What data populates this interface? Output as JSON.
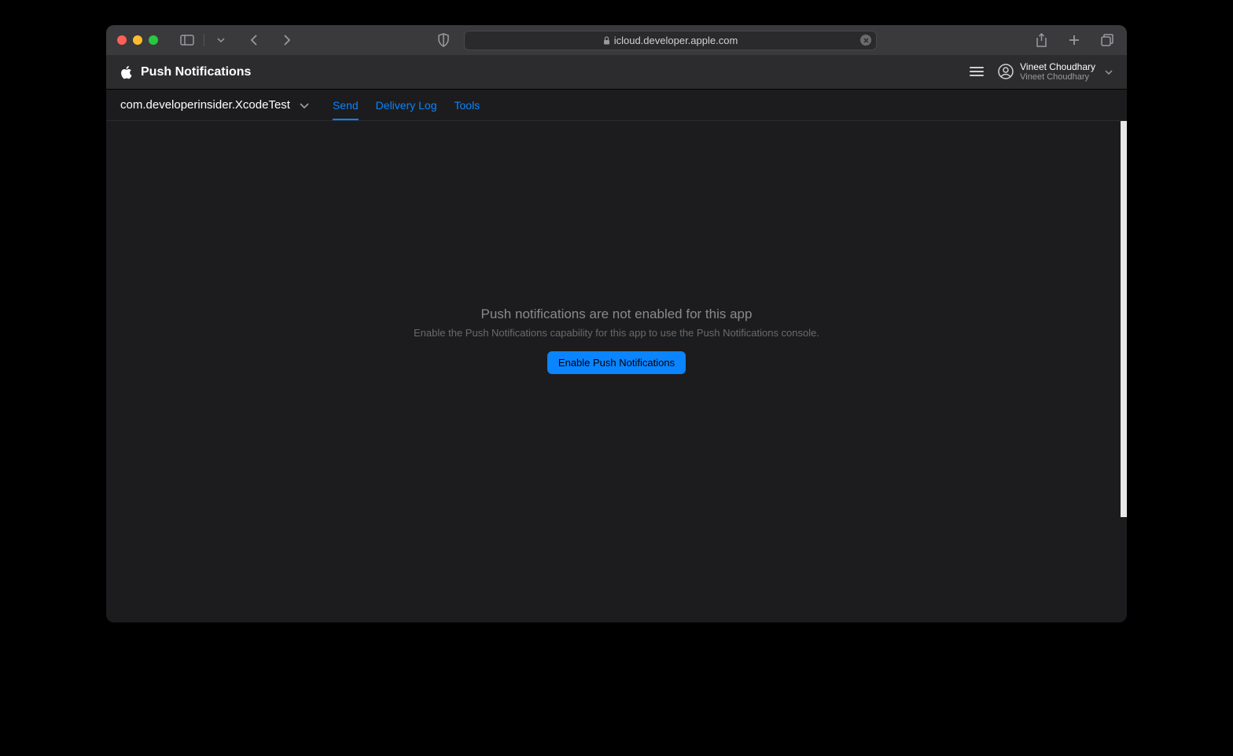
{
  "browser": {
    "url": "icloud.developer.apple.com"
  },
  "header": {
    "title": "Push Notifications",
    "user": {
      "name": "Vineet Choudhary",
      "sub": "Vineet Choudhary"
    }
  },
  "subheader": {
    "bundle_id": "com.developerinsider.XcodeTest",
    "tabs": [
      {
        "label": "Send",
        "active": true
      },
      {
        "label": "Delivery Log",
        "active": false
      },
      {
        "label": "Tools",
        "active": false
      }
    ]
  },
  "empty_state": {
    "title": "Push notifications are not enabled for this app",
    "subtitle": "Enable the Push Notifications capability for this app to use the Push Notifications console.",
    "button": "Enable Push Notifications"
  }
}
